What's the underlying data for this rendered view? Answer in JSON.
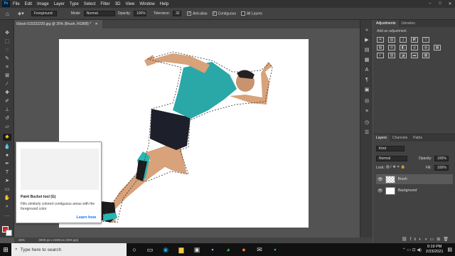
{
  "app": {
    "logo": "Ps"
  },
  "menu": [
    "File",
    "Edit",
    "Image",
    "Layer",
    "Type",
    "Select",
    "Filter",
    "3D",
    "View",
    "Window",
    "Help"
  ],
  "window_controls": [
    "–",
    "□",
    "✕"
  ],
  "options": {
    "fill_source": "Foreground",
    "mode_label": "Mode:",
    "mode_value": "Normal",
    "opacity_label": "Opacity:",
    "opacity_value": "100%",
    "tolerance_label": "Tolerance:",
    "tolerance_value": "32",
    "antialias": "Anti-alias",
    "contiguous": "Contiguous",
    "all_layers": "All Layers"
  },
  "document": {
    "tab_title": "iStock-515232220.jpg @ 25% (Brush, RGB/8) *",
    "close": "✕"
  },
  "status": {
    "zoom": "25%",
    "dimensions": "3000 px x 2248 px (300 ppi)"
  },
  "tooltip": {
    "title": "Paint Bucket tool (G)",
    "desc": "Fills similarly colored contiguous areas with the foreground color",
    "link": "Learn how"
  },
  "panels": {
    "adjustments": {
      "tab1": "Adjustments",
      "tab2": "Libraries",
      "add": "Add an adjustment"
    },
    "layers": {
      "tab1": "Layers",
      "tab2": "Channels",
      "tab3": "Paths",
      "kind": "Kind",
      "blend": "Normal",
      "opacity_label": "Opacity:",
      "opacity_value": "100%",
      "lock_label": "Lock:",
      "fill_label": "Fill:",
      "fill_value": "100%",
      "items": [
        {
          "name": "Brush",
          "selected": true
        },
        {
          "name": "Background",
          "selected": false
        }
      ]
    }
  },
  "taskbar": {
    "search_placeholder": "Type here to search",
    "time": "9:19 PM",
    "date": "2/23/2021"
  },
  "colors": {
    "accent": "#1473e6",
    "foreground": "#e02020",
    "background": "#ffffff",
    "runner_shirt": "#2aa8a8"
  }
}
